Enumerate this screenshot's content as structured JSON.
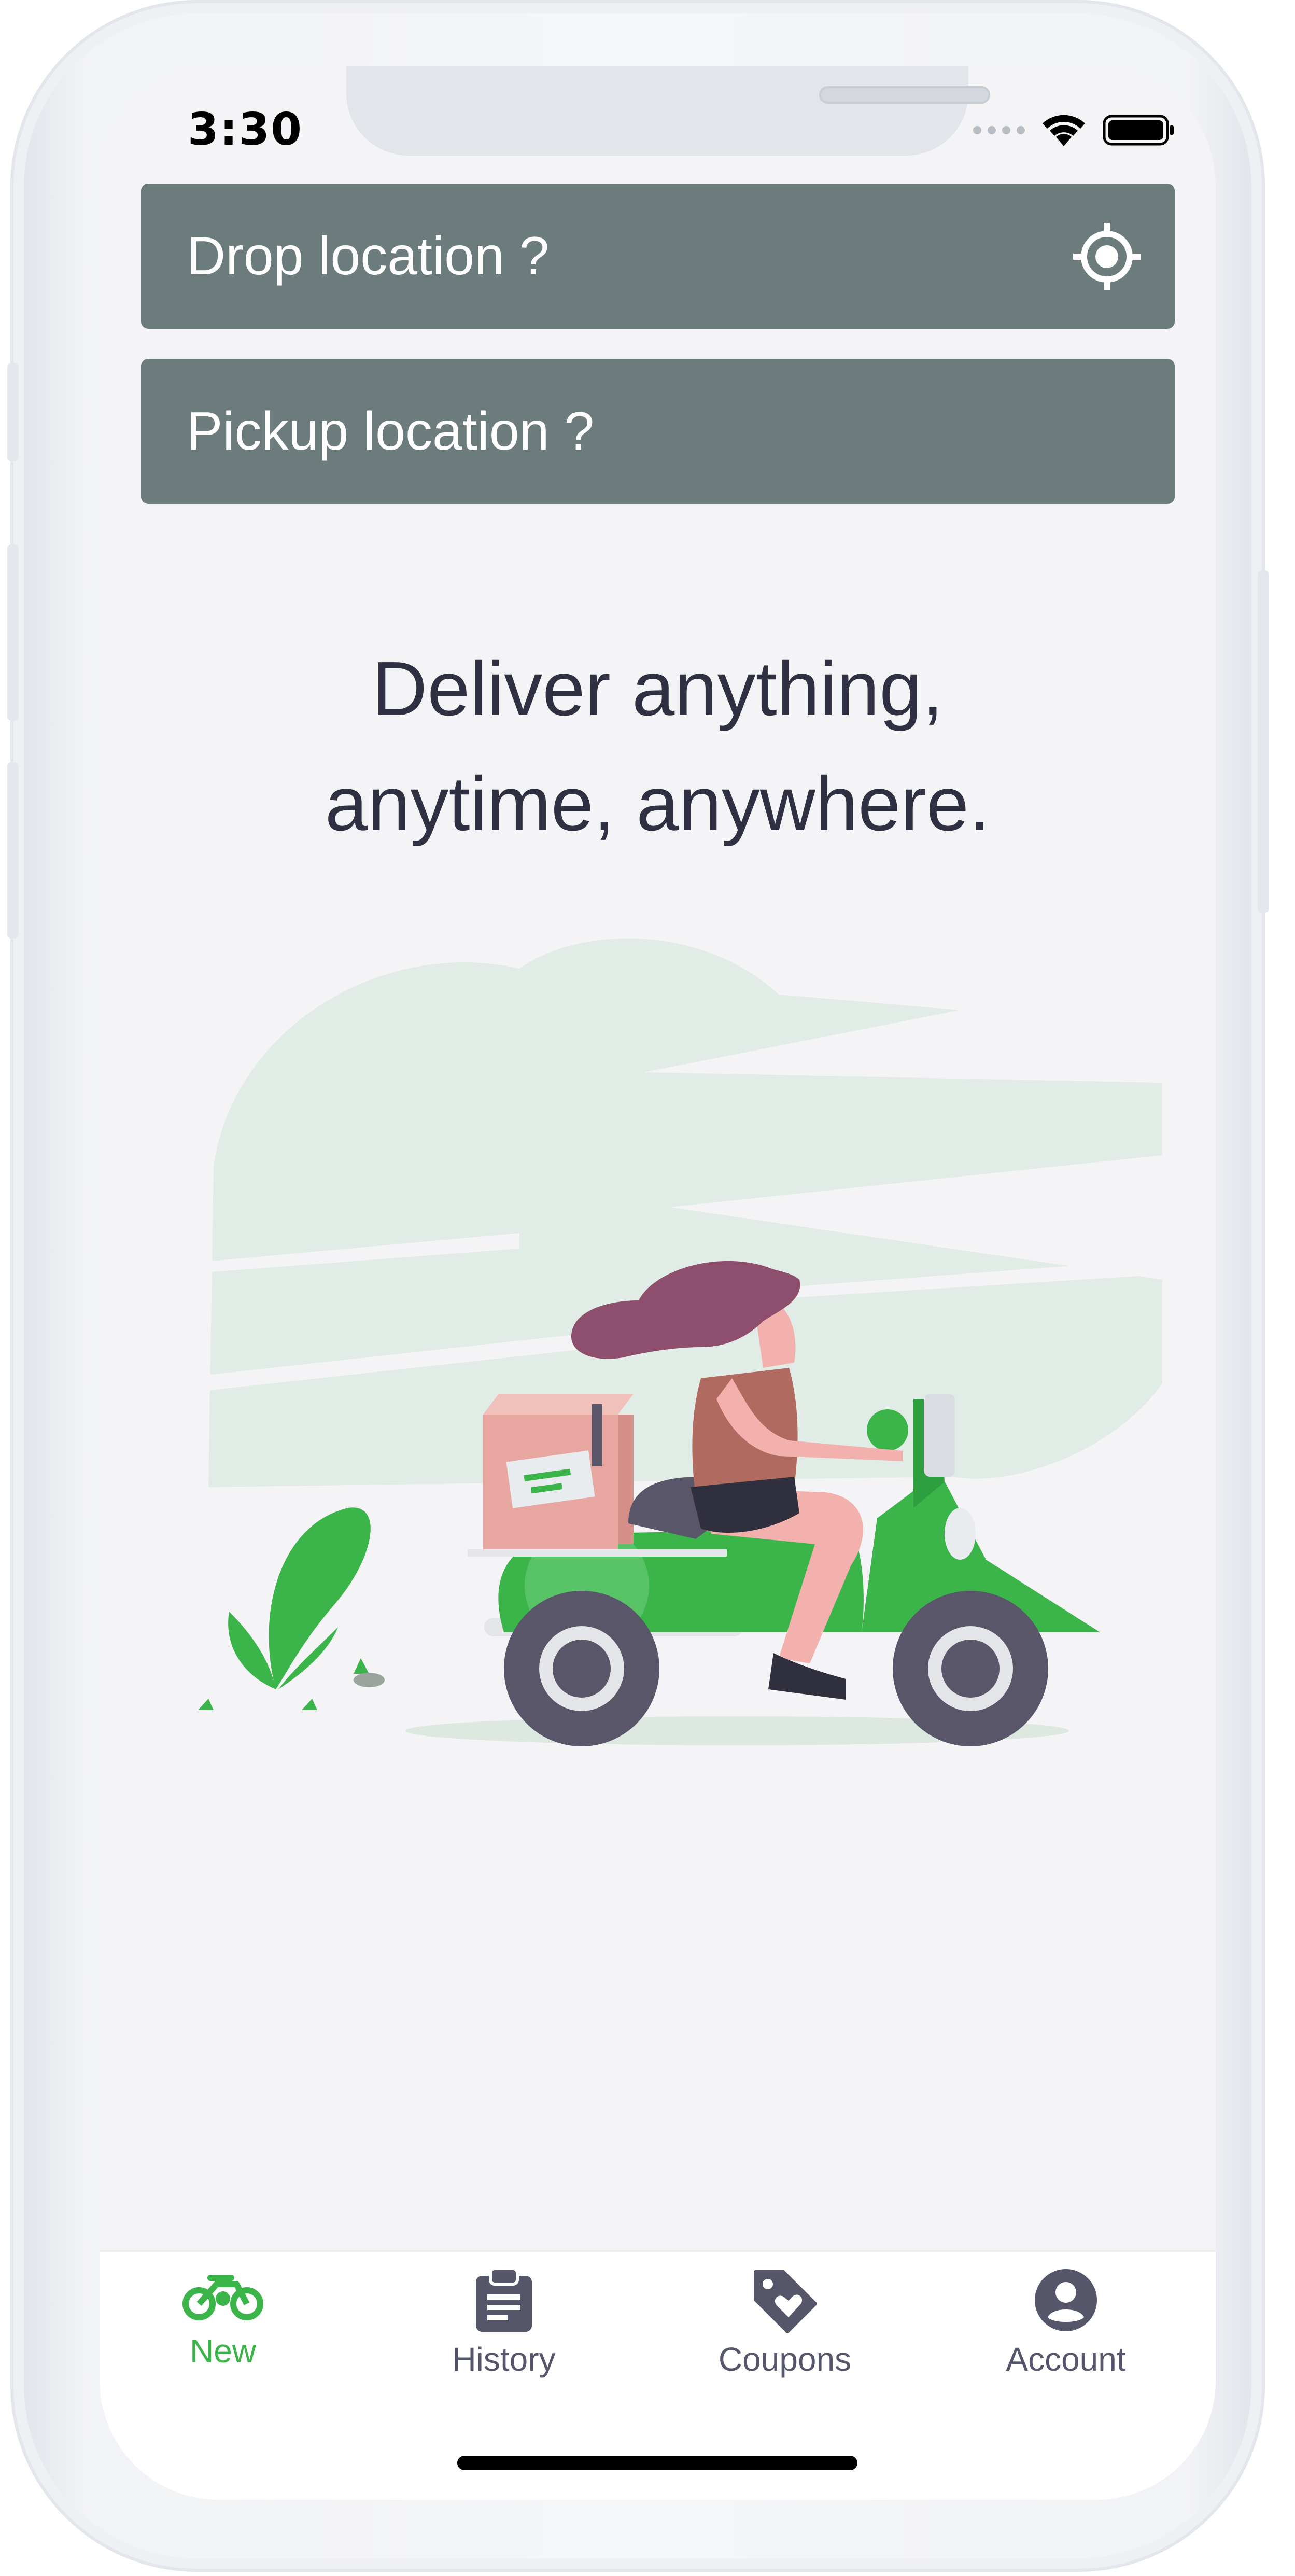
{
  "status_bar": {
    "time": "3:30"
  },
  "drop_location": {
    "placeholder": "Drop location ?"
  },
  "pickup_location": {
    "placeholder": "Pickup location ?"
  },
  "headline": {
    "line1": "Deliver anything,",
    "line2": "anytime, anywhere."
  },
  "tabs": [
    {
      "label": "New",
      "icon": "bike-icon",
      "active": true
    },
    {
      "label": "History",
      "icon": "clipboard-icon",
      "active": false
    },
    {
      "label": "Coupons",
      "icon": "tag-heart-icon",
      "active": false
    },
    {
      "label": "Account",
      "icon": "account-circle-icon",
      "active": false
    }
  ],
  "colors": {
    "accent": "#3bb54a",
    "location_bar": "#6c7c7c",
    "headline": "#2f3041",
    "tab_inactive": "#55566a"
  }
}
